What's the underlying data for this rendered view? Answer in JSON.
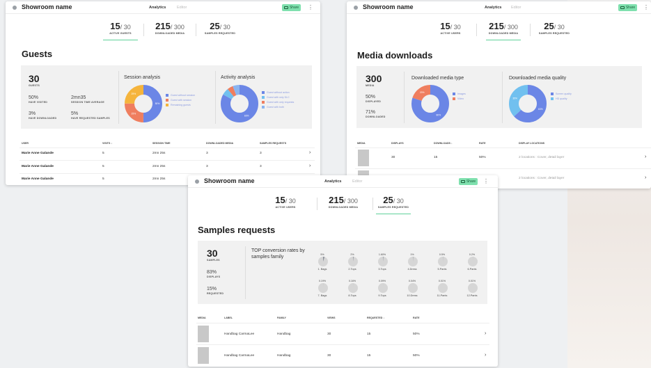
{
  "guests_card": {
    "title": "Showroom name",
    "tab_analytics": "Analytics",
    "tab_editor": "Editor",
    "share": "Share",
    "stats": [
      {
        "value": "15",
        "total": "/ 30",
        "label": "ACTIVE GUESTS"
      },
      {
        "value": "215",
        "total": "/ 300",
        "label": "DOWNLOADED MEDIA"
      },
      {
        "value": "25",
        "total": "/ 30",
        "label": "SAMPLES REQUESTED"
      }
    ],
    "section_title": "Guests",
    "summary": {
      "count": "30",
      "count_label": "GUESTS",
      "visited": "50%",
      "visited_label": "HAVE VISITED",
      "session": "2mn35",
      "session_label": "SESSION TIME AVERAGE",
      "downloads": "3%",
      "downloads_label": "HAVE DOWNLOADED",
      "requested": "5%",
      "requested_label": "HAVE REQUESTED SAMPLES"
    },
    "session_analysis": {
      "heading": "Session analysis",
      "slices": [
        {
          "label": "Guest without session",
          "value": 50,
          "text": "50%",
          "color": "#6b86e6"
        },
        {
          "label": "Guest with session",
          "value": 25,
          "text": "25%",
          "color": "#ef7e5f"
        },
        {
          "label": "Remaining guests",
          "value": 25,
          "text": "25%",
          "color": "#f5b43c"
        }
      ]
    },
    "activity_analysis": {
      "heading": "Activity analysis",
      "slices": [
        {
          "label": "Guest without action",
          "value": 83,
          "text": "83%",
          "color": "#6b86e6"
        },
        {
          "label": "Guest with only DLC",
          "value": 6,
          "text": "",
          "color": "#71c0ef"
        },
        {
          "label": "Guest with only requests",
          "value": 5,
          "text": "",
          "color": "#ef7e5f"
        },
        {
          "label": "Guest with both",
          "value": 6,
          "text": "",
          "color": "#8ab4f0"
        }
      ]
    },
    "table": {
      "headers": [
        "USER",
        "VISITS",
        "SESSION TIME",
        "DOWNLOADED MEDIA",
        "SAMPLES REQUESTS"
      ],
      "rows": [
        [
          "Marie Anne Galande",
          "5",
          "2mn 25s",
          "3",
          "3"
        ],
        [
          "Marie Anne Galande",
          "5",
          "2mn 25s",
          "3",
          "3"
        ],
        [
          "Marie Anne Galande",
          "5",
          "2mn 25s",
          "3",
          "3"
        ]
      ]
    }
  },
  "media_card": {
    "title": "Showroom name",
    "tab_analytics": "Analytics",
    "tab_editor": "Editor",
    "share": "Share",
    "stats": [
      {
        "value": "15",
        "total": "/ 30",
        "label": "ACTIVE USERS"
      },
      {
        "value": "215",
        "total": "/ 300",
        "label": "DOWNLOADED MEDIA"
      },
      {
        "value": "25",
        "total": "/ 30",
        "label": "SAMPLES REQUESTED"
      }
    ],
    "section_title": "Media downloads",
    "summary": {
      "count": "300",
      "count_label": "MEDIA",
      "displayed": "50%",
      "displayed_label": "DISPLAYED",
      "downloaded": "71%",
      "downloaded_label": "DOWNLOADED"
    },
    "media_type": {
      "heading": "Downloaded media type",
      "slices": [
        {
          "label": "Images",
          "value": 80,
          "text": "80%",
          "color": "#6b86e6"
        },
        {
          "label": "Video",
          "value": 20,
          "text": "20%",
          "color": "#ef7e5f"
        }
      ]
    },
    "media_quality": {
      "heading": "Downloaded media quality",
      "slices": [
        {
          "label": "Screen quality",
          "value": 63,
          "text": "63%",
          "color": "#6b86e6"
        },
        {
          "label": "HD quality",
          "value": 37,
          "text": "35%",
          "color": "#71c0ef"
        }
      ]
    },
    "table": {
      "headers": [
        "MEDIA",
        "DISPLAYS",
        "DOWNLOADS",
        "RATE",
        "DISPLAY LOCATIONS"
      ],
      "rows": [
        [
          "30",
          "15",
          "50%",
          "2 locations : Cover, detail layer"
        ],
        [
          "30",
          "15",
          "50%",
          "2 locations : Cover, detail layer"
        ]
      ]
    }
  },
  "samples_card": {
    "title": "Showroom name",
    "tab_analytics": "Analytics",
    "tab_editor": "Editor",
    "share": "Share",
    "stats": [
      {
        "value": "15",
        "total": "/ 30",
        "label": "ACTIVE USERS"
      },
      {
        "value": "215",
        "total": "/ 300",
        "label": "DOWNLOADED MEDIA"
      },
      {
        "value": "25",
        "total": "/ 30",
        "label": "SAMPLES REQUESTED"
      }
    ],
    "section_title": "Samples requests",
    "summary": {
      "count": "30",
      "count_label": "SAMPLES",
      "displays": "83%",
      "displays_label": "DISPLAYS",
      "requested": "15%",
      "requested_label": "REQUESTED"
    },
    "conversion_heading": "TOP conversion rates by samples family",
    "conversion": [
      {
        "pct": "5%",
        "value": 5,
        "label": "1. Bags"
      },
      {
        "pct": "2%",
        "value": 2,
        "label": "2.Tops"
      },
      {
        "pct": "1.60%",
        "value": 1.6,
        "label": "3.Tops"
      },
      {
        "pct": "1%",
        "value": 1,
        "label": "4.Dress"
      },
      {
        "pct": "0.5%",
        "value": 0.5,
        "label": "5.Pants"
      },
      {
        "pct": "0.2%",
        "value": 0.2,
        "label": "6.Pants"
      },
      {
        "pct": "0.19%",
        "value": 0.19,
        "label": "7. Bags"
      },
      {
        "pct": "0.16%",
        "value": 0.16,
        "label": "8.Tops"
      },
      {
        "pct": "0.09%",
        "value": 0.09,
        "label": "9.Tops"
      },
      {
        "pct": "0.04%",
        "value": 0.04,
        "label": "10.Dress"
      },
      {
        "pct": "0.01%",
        "value": 0.01,
        "label": "11.Pants"
      },
      {
        "pct": "0.01%",
        "value": 0.01,
        "label": "12.Pants"
      }
    ],
    "table": {
      "headers": [
        "MEDIA",
        "LABEL",
        "FAMILY",
        "VIEWS",
        "REQUESTED",
        "RATE"
      ],
      "rows": [
        [
          "Handbag CarmaLee",
          "Handbag",
          "30",
          "15",
          "50%"
        ],
        [
          "Handbag CarmaLee",
          "Handbag",
          "30",
          "15",
          "50%"
        ]
      ]
    }
  },
  "icons": {
    "sort": "arrow-down-icon",
    "row": "chevron-right-icon",
    "share": "share-icon",
    "menu": "more-vertical-icon",
    "app": "dot-icon"
  }
}
